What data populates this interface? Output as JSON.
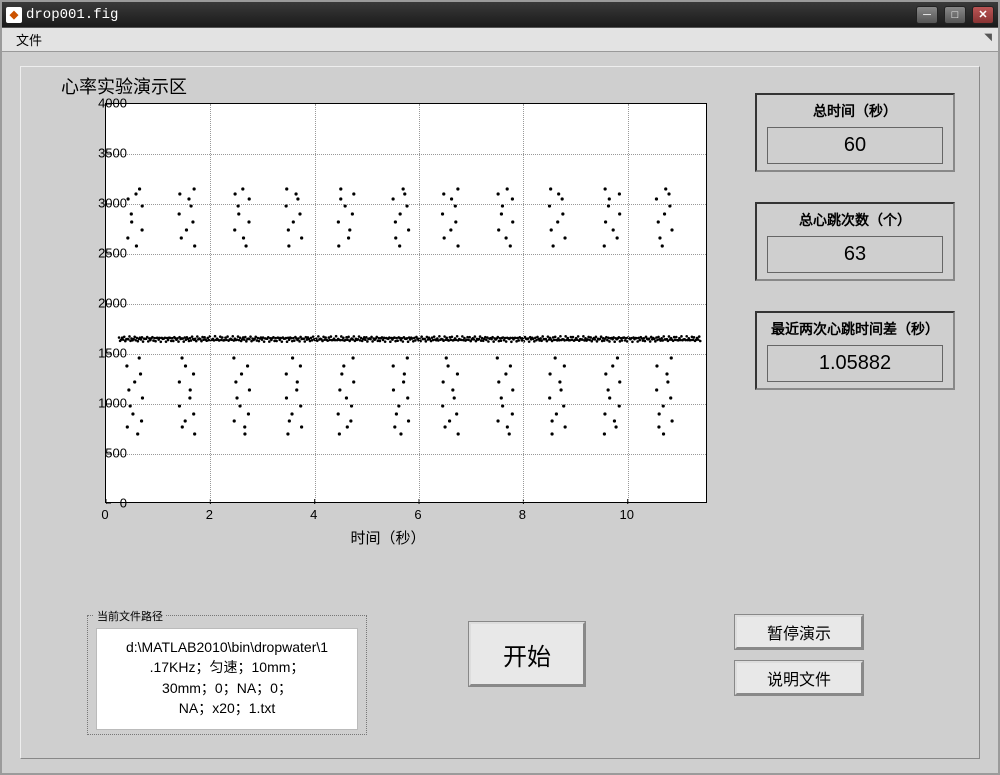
{
  "window": {
    "title": "drop001.fig",
    "app_icon_text": "◆"
  },
  "menubar": {
    "file": "文件"
  },
  "chart_region": {
    "title": "心率实验演示区",
    "xlabel": "时间（秒）"
  },
  "readouts": {
    "total_time": {
      "label": "总时间（秒）",
      "value": "60"
    },
    "total_beats": {
      "label": "总心跳次数（个）",
      "value": "63"
    },
    "last_interval": {
      "label": "最近两次心跳时间差（秒）",
      "value": "1.05882"
    }
  },
  "buttons": {
    "start": "开始",
    "pause": "暂停演示",
    "help": "说明文件"
  },
  "filepath": {
    "label": "当前文件路径",
    "l1": "d:\\MATLAB2010\\bin\\dropwater\\1",
    "l2": ".17KHz；匀速；10mm；",
    "l3": "30mm；0；NA；0；",
    "l4": "NA；x20；1.txt"
  },
  "chart_data": {
    "type": "scatter",
    "title": "心率实验演示区",
    "xlabel": "时间（秒）",
    "ylabel": "",
    "xlim": [
      0,
      11.5
    ],
    "ylim": [
      0,
      4000
    ],
    "xticks": [
      0,
      2,
      4,
      6,
      8,
      10
    ],
    "yticks": [
      0,
      500,
      1000,
      1500,
      2000,
      2500,
      3000,
      3500,
      4000
    ],
    "baseline_y": 1650,
    "event_x": [
      0.55,
      1.55,
      2.6,
      3.6,
      4.6,
      5.65,
      6.6,
      7.65,
      8.65,
      9.7,
      10.7
    ],
    "event_y_samples": [
      700,
      770,
      830,
      900,
      980,
      1060,
      1140,
      1220,
      1300,
      1380,
      1460,
      2580,
      2660,
      2740,
      2820,
      2900,
      2980,
      3050,
      3100,
      3150
    ],
    "x_jitter": 0.15
  }
}
